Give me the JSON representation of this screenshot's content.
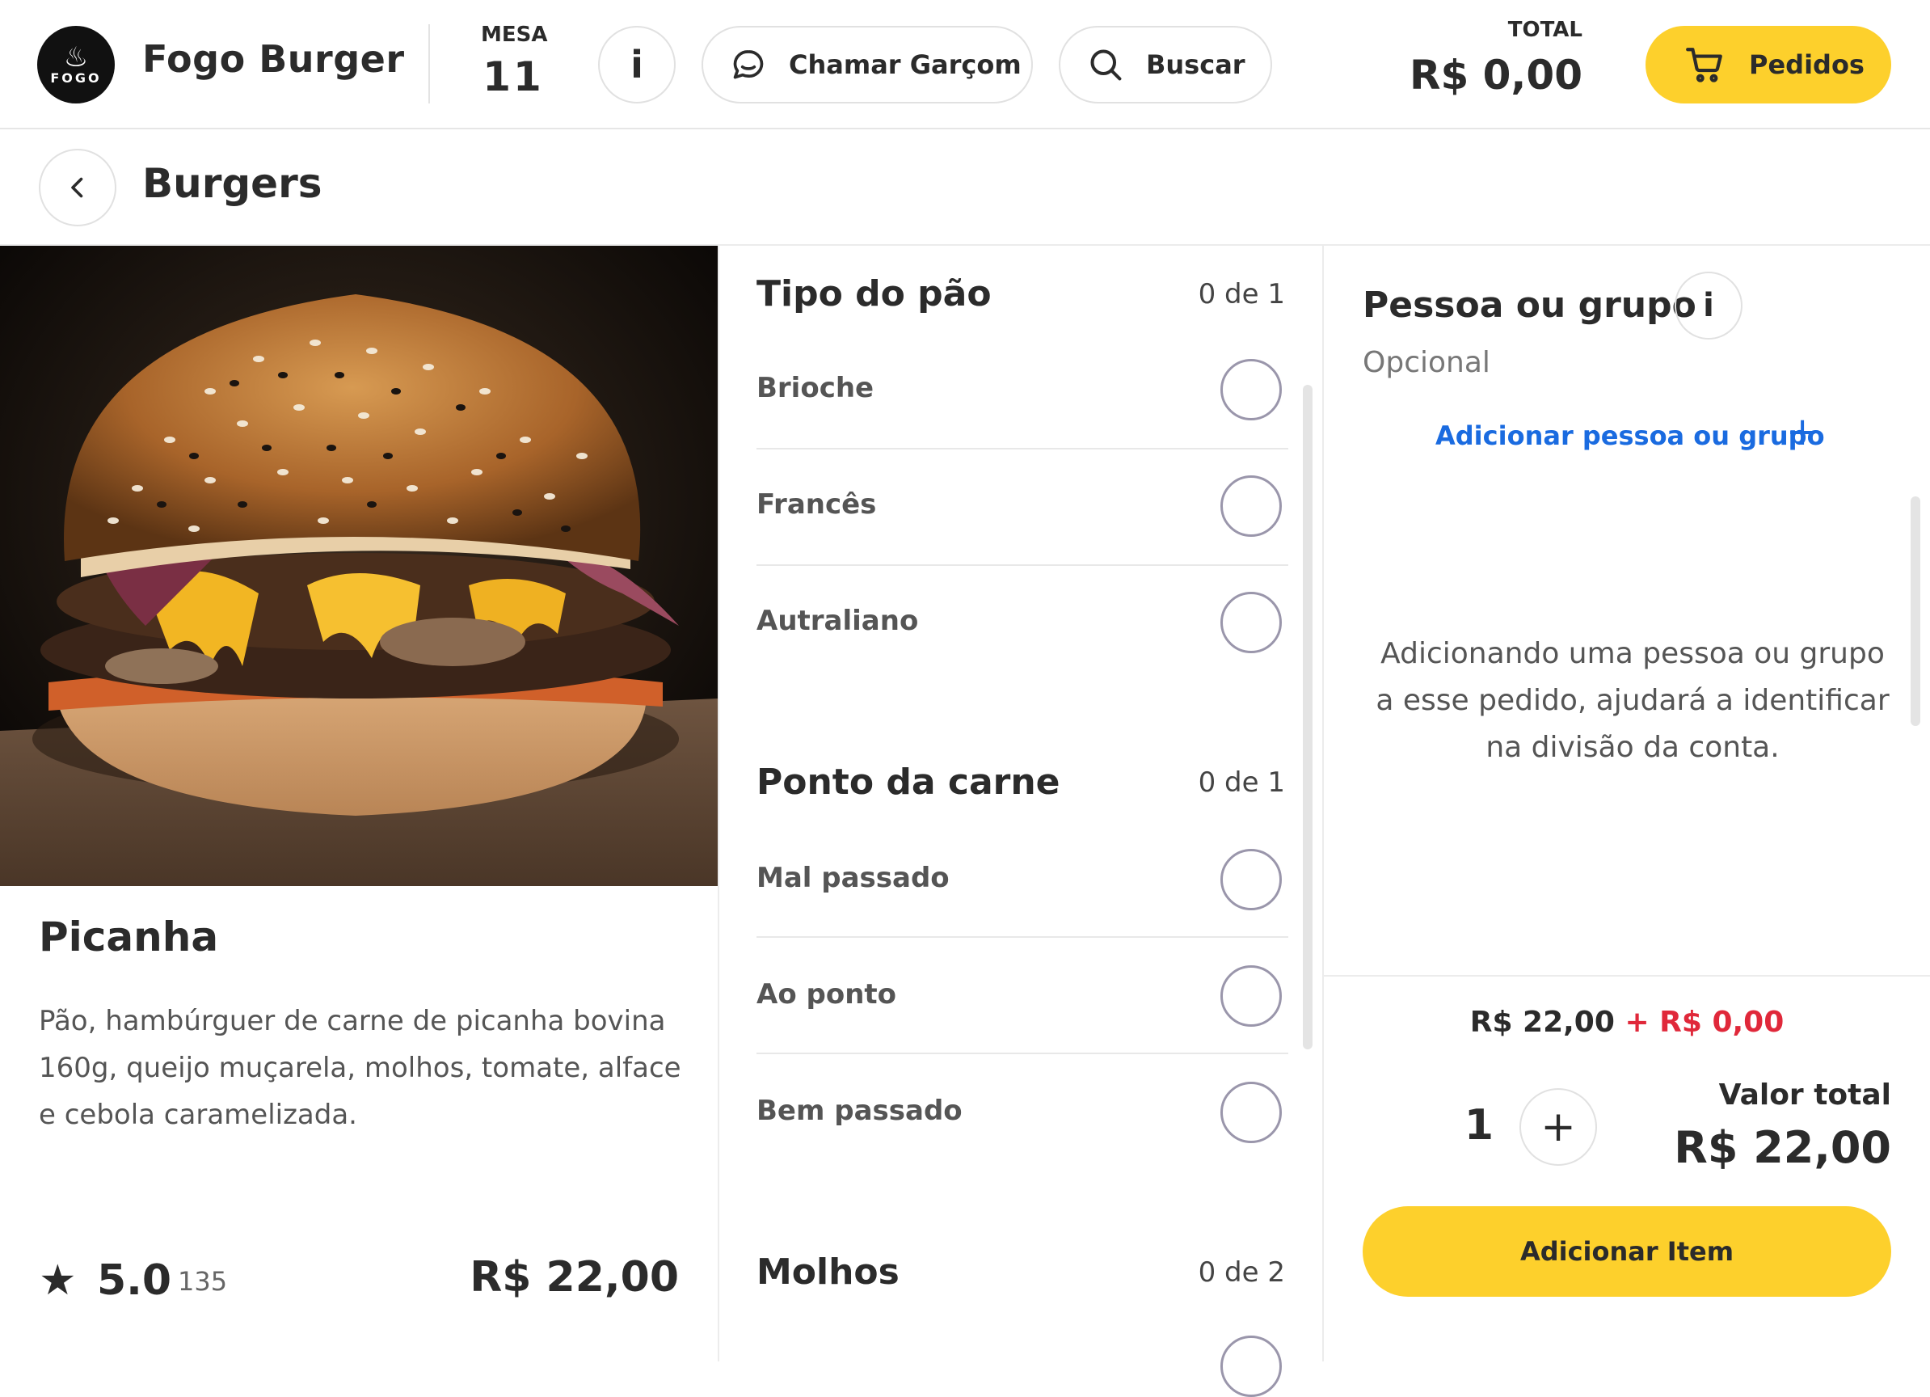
{
  "header": {
    "brand_name": "Fogo Burger",
    "logo_text": "FOGO",
    "table_label": "MESA",
    "table_number": "11",
    "info_label": "i",
    "call_waiter_label": "Chamar Garçom",
    "search_label": "Buscar",
    "total_label": "TOTAL",
    "total_value": "R$ 0,00",
    "orders_label": "Pedidos",
    "accent_color": "#fdd02c"
  },
  "page": {
    "title": "Burgers"
  },
  "product": {
    "name": "Picanha",
    "description": "Pão, hambúrguer de carne de picanha bovina 160g, queijo muçarela, molhos, tomate, alface e cebola caramelizada.",
    "rating": "5.0",
    "rating_count": "135",
    "price": "R$ 22,00"
  },
  "options": {
    "groups": [
      {
        "title": "Tipo do pão",
        "count": "0 de 1",
        "items": [
          "Brioche",
          "Francês",
          "Autraliano"
        ]
      },
      {
        "title": "Ponto da carne",
        "count": "0 de 1",
        "items": [
          "Mal passado",
          "Ao ponto",
          "Bem passado"
        ]
      },
      {
        "title": "Molhos",
        "count": "0 de 2",
        "items": []
      }
    ]
  },
  "person": {
    "title": "Pessoa ou grupo",
    "info_label": "i",
    "optional_label": "Opcional",
    "add_link": "Adicionar pessoa ou grupo",
    "add_symbol": "+",
    "help_text": "Adicionando uma pessoa ou grupo a esse pedido, ajudará a identificar na divisão da conta."
  },
  "summary": {
    "base_price": "R$ 22,00",
    "extra_price": "+ R$ 0,00",
    "quantity": "1",
    "plus_symbol": "+",
    "total_label": "Valor total",
    "total_value": "R$ 22,00",
    "add_button": "Adicionar Item",
    "extra_color": "#e0283a",
    "link_color": "#1a6be0"
  }
}
